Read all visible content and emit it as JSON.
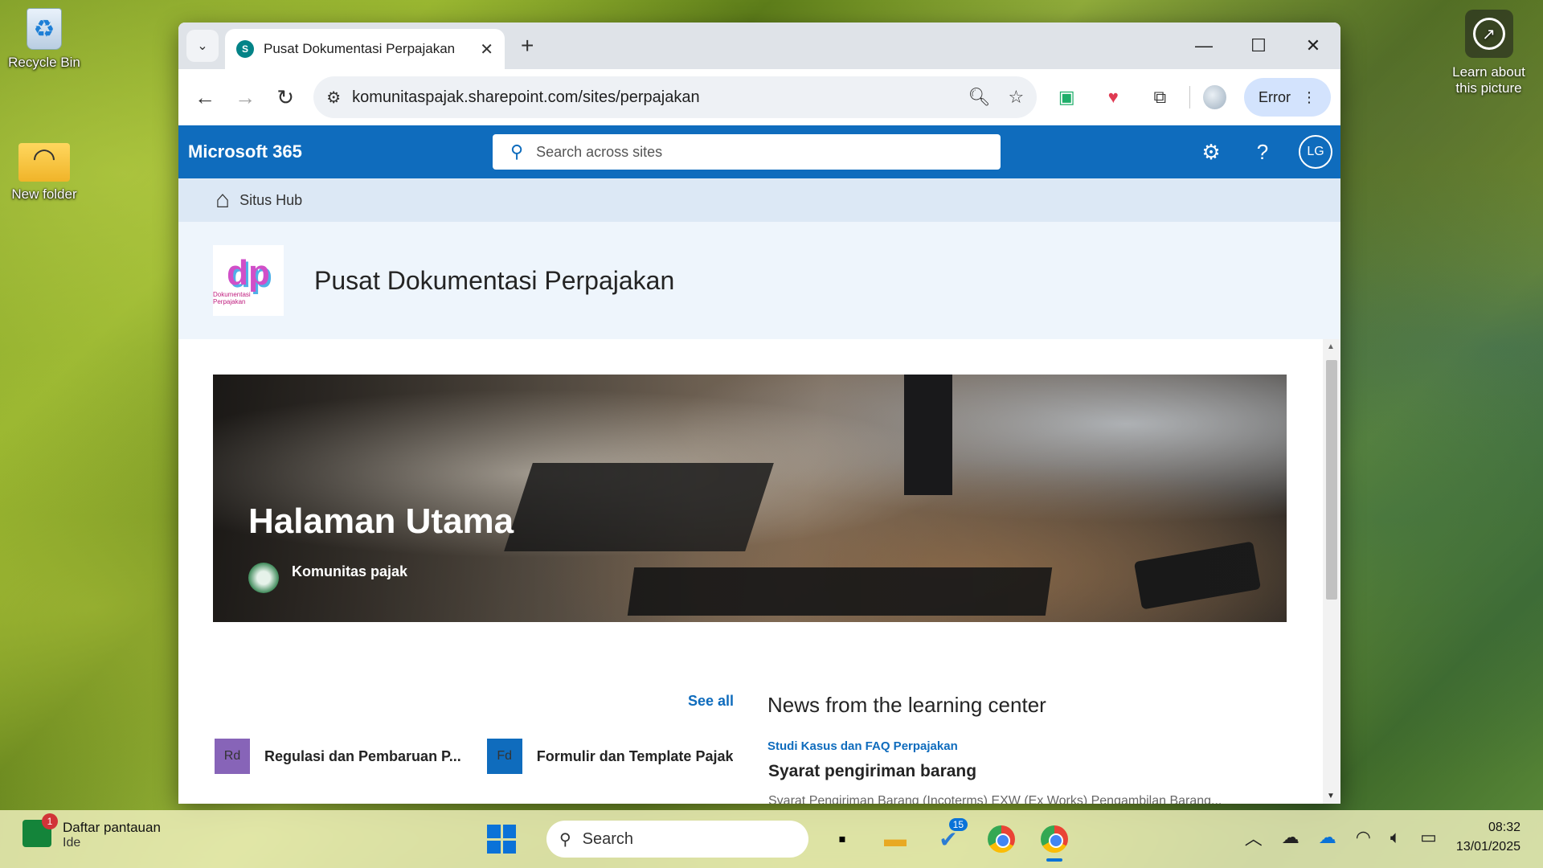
{
  "desktop": {
    "icons": [
      {
        "label": "Recycle Bin"
      },
      {
        "label": "New folder"
      }
    ],
    "learn_about": "Learn about this picture"
  },
  "browser": {
    "tab": {
      "favicon_text": "S",
      "title": "Pusat Dokumentasi Perpajakan",
      "close": "✕"
    },
    "new_tab": "+",
    "window_controls": {
      "minimize": "—",
      "maximize": "☐",
      "close": "✕"
    },
    "nav": {
      "back": "←",
      "forward": "→",
      "reload": "↻"
    },
    "url": "komunitaspajak.sharepoint.com/sites/perpajakan",
    "error_label": "Error"
  },
  "sharepoint": {
    "brand": "Microsoft 365",
    "search_placeholder": "Search across sites",
    "avatar_initials": "LG",
    "hub_name": "Situs Hub",
    "site_logo_text": "dp",
    "site_logo_sub": "Dokumentasi Perpajakan",
    "site_title": "Pusat Dokumentasi Perpajakan",
    "hero": {
      "title": "Halaman Utama",
      "author": "Komunitas pajak"
    },
    "see_all": "See all",
    "quick_links": [
      {
        "badge": "Rd",
        "label": "Regulasi dan Pembaruan P..."
      },
      {
        "badge": "Fd",
        "label": "Formulir dan Template Pajak"
      }
    ],
    "news": {
      "heading": "News from the learning center",
      "category": "Studi Kasus dan FAQ Perpajakan",
      "title": "Syarat pengiriman barang",
      "snippet": "Syarat Pengiriman Barang (Incoterms) EXW (Ex Works) Pengambilan Barang..."
    }
  },
  "taskbar": {
    "watchlist_title": "Daftar pantauan",
    "watchlist_sub": "Ide",
    "watchlist_badge": "1",
    "search_label": "Search",
    "todo_badge": "15",
    "time": "08:32",
    "date": "13/01/2025"
  }
}
